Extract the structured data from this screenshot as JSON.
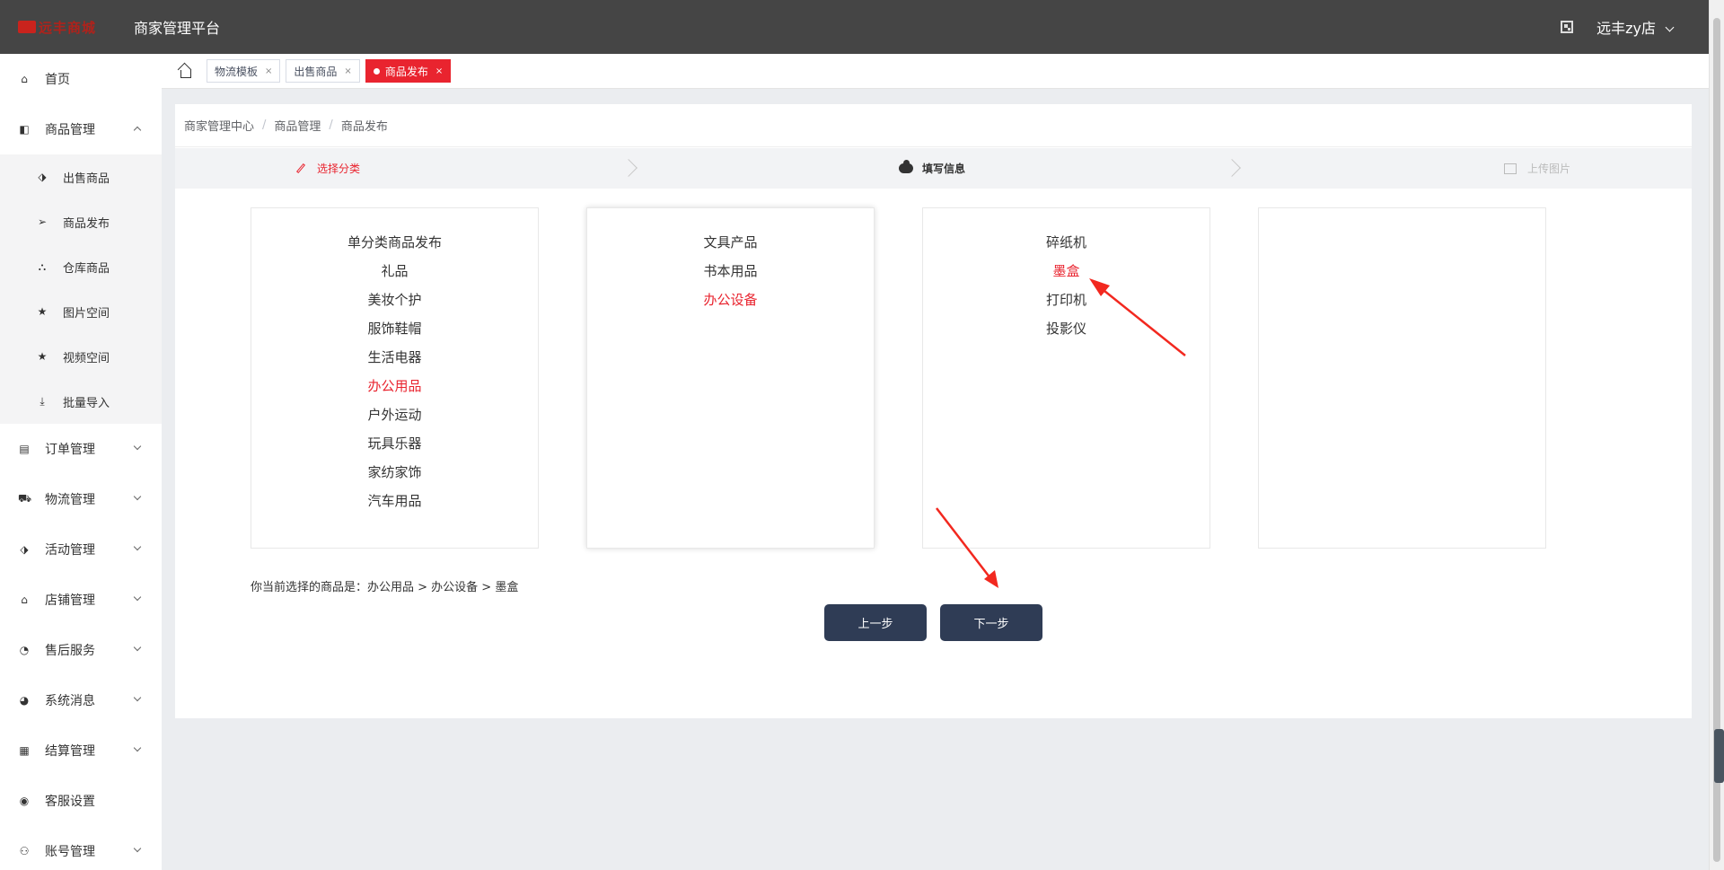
{
  "header": {
    "logo_text": "远丰商城",
    "platform_title": "商家管理平台",
    "user_name": "远丰zy店"
  },
  "sidebar": {
    "items": [
      {
        "label": "首页",
        "icon": "home-icon",
        "glyph": "⌂"
      },
      {
        "label": "商品管理",
        "icon": "goods-icon",
        "glyph": "◧",
        "expanded": true,
        "children": [
          {
            "label": "出售商品",
            "icon": "tag-icon",
            "glyph": "⬗"
          },
          {
            "label": "商品发布",
            "icon": "send-icon",
            "glyph": "➢"
          },
          {
            "label": "仓库商品",
            "icon": "warehouse-icon",
            "glyph": "⛬"
          },
          {
            "label": "图片空间",
            "icon": "star-icon",
            "glyph": "★"
          },
          {
            "label": "视频空间",
            "icon": "star-icon",
            "glyph": "★"
          },
          {
            "label": "批量导入",
            "icon": "import-icon",
            "glyph": "⤓"
          }
        ]
      },
      {
        "label": "订单管理",
        "icon": "order-icon",
        "glyph": "▤"
      },
      {
        "label": "物流管理",
        "icon": "truck-icon",
        "glyph": "⛟"
      },
      {
        "label": "活动管理",
        "icon": "activity-icon",
        "glyph": "⬗"
      },
      {
        "label": "店铺管理",
        "icon": "shop-icon",
        "glyph": "⌂"
      },
      {
        "label": "售后服务",
        "icon": "service-icon",
        "glyph": "◔"
      },
      {
        "label": "系统消息",
        "icon": "message-icon",
        "glyph": "◕"
      },
      {
        "label": "结算管理",
        "icon": "settlement-icon",
        "glyph": "▦"
      },
      {
        "label": "客服设置",
        "icon": "customer-service-icon",
        "glyph": "◉"
      },
      {
        "label": "账号管理",
        "icon": "account-icon",
        "glyph": "⚇"
      }
    ]
  },
  "tags": [
    {
      "label": "物流模板",
      "active": false
    },
    {
      "label": "出售商品",
      "active": false
    },
    {
      "label": "商品发布",
      "active": true
    }
  ],
  "breadcrumb": [
    "商家管理中心",
    "商品管理",
    "商品发布"
  ],
  "steps": {
    "step1": "选择分类",
    "step2": "填写信息",
    "step3": "上传图片"
  },
  "categories": {
    "level1": [
      "单分类商品发布",
      "礼品",
      "美妆个护",
      "服饰鞋帽",
      "生活电器",
      "办公用品",
      "户外运动",
      "玩具乐器",
      "家纺家饰",
      "汽车用品"
    ],
    "level1_selected": 5,
    "level2": [
      "文具产品",
      "书本用品",
      "办公设备"
    ],
    "level2_selected": 2,
    "level3": [
      "碎纸机",
      "墨盒",
      "打印机",
      "投影仪"
    ],
    "level3_selected": 1
  },
  "current_selection": "你当前选择的商品是：办公用品 > 办公设备 > 墨盒",
  "buttons": {
    "prev": "上一步",
    "next": "下一步"
  },
  "colors": {
    "accent": "#e9242f",
    "header_bg": "#454545",
    "button_bg": "#2f3c55"
  }
}
